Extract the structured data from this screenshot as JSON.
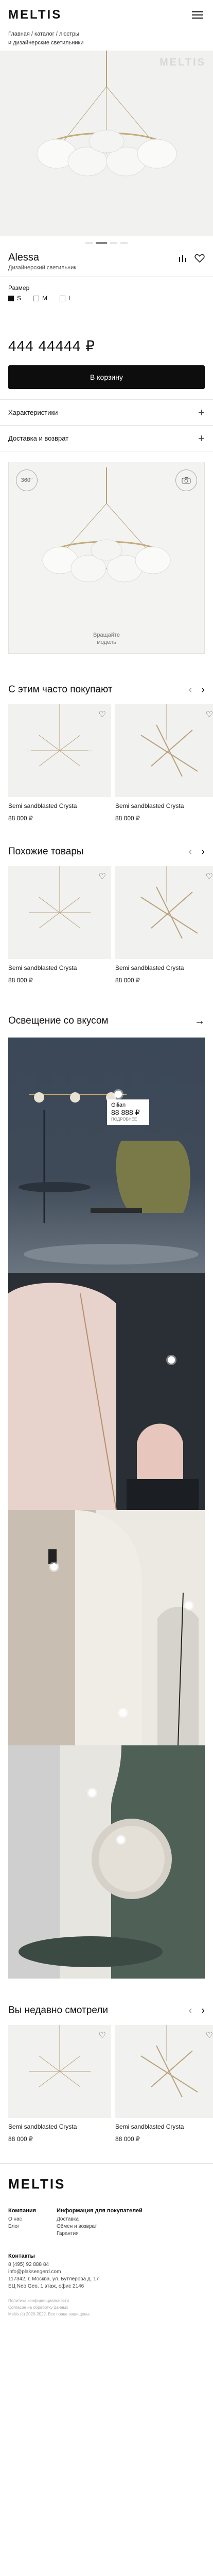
{
  "header": {
    "logo": "MELTIS",
    "breadcrumb": "Главная / каталог / люстры\nи дизайнерские светильники"
  },
  "gallery": {
    "watermark": "MELTIS",
    "slides": 4,
    "active": 1
  },
  "product": {
    "name": "Alessa",
    "category": "Дизайнерский светильник",
    "size_label": "Размер",
    "sizes": [
      "S",
      "M",
      "L"
    ],
    "selected_size": "S",
    "price": "444 44444 ₽",
    "buy_label": "В корзину",
    "accordion": [
      "Характеристики",
      "Доставка и возврат"
    ],
    "viewer_badge": "360°",
    "rotate_label": "Вращайте\nмодель"
  },
  "sections": {
    "bought_together": {
      "title": "С этим часто покупают",
      "cards": [
        {
          "name": "Semi sandblasted Crysta",
          "price": "88 000 ₽"
        },
        {
          "name": "Semi sandblasted Crysta",
          "price": "88 000 ₽"
        }
      ]
    },
    "similar": {
      "title": "Похожие товары",
      "cards": [
        {
          "name": "Semi sandblasted Crysta",
          "price": "88 000 ₽"
        },
        {
          "name": "Semi sandblasted Crysta",
          "price": "88 000 ₽"
        }
      ]
    },
    "inspiration": {
      "title": "Освещение со вкусом",
      "tag": {
        "name": "Gilian",
        "price": "88 888 ₽",
        "small": "ПОДРОБНЕЕ"
      }
    },
    "recent": {
      "title": "Вы недавно смотрели",
      "cards": [
        {
          "name": "Semi sandblasted Crysta",
          "price": "88 000 ₽"
        },
        {
          "name": "Semi sandblasted Crysta",
          "price": "88 000 ₽"
        }
      ]
    }
  },
  "footer": {
    "logo": "MELTIS",
    "col1": {
      "title": "Компания",
      "items": [
        "О нас",
        "Блог"
      ]
    },
    "col2": {
      "title": "Информация для покупателей",
      "items": [
        "Доставка",
        "Обмен и возврат",
        "Гарантия"
      ]
    },
    "contacts": {
      "title": "Контакты",
      "lines": [
        "8 (495) 92 888 84",
        "info@plaksengerd.com",
        "117342, г. Москва, ул. Бутлерова д. 17",
        "БЦ Neo Geo, 1 этаж, офис 2146"
      ]
    },
    "legal": [
      "Политика конфиденциальности",
      "Согласие на обработку данных",
      "Meltis (с) 2020-2022. Все права защищены."
    ]
  }
}
